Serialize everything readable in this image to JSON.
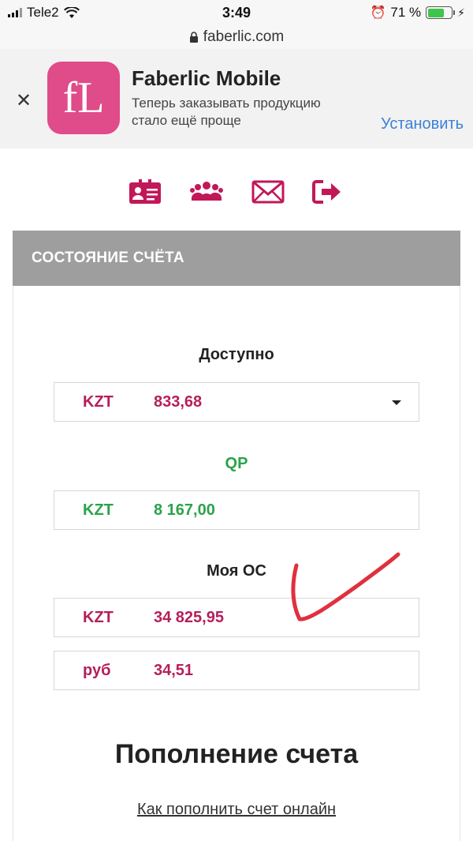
{
  "status_bar": {
    "carrier": "Tele2",
    "time": "3:49",
    "battery_percent": "71 %",
    "battery_level": 0.71
  },
  "url_bar": {
    "url": "faberlic.com"
  },
  "app_banner": {
    "icon_text": "fL",
    "app_name": "Faberlic Mobile",
    "description_line1": "Теперь заказывать продукцию",
    "description_line2": "стало ещё проще",
    "install_label": "Установить",
    "icon_color": "#e04b8a"
  },
  "nav_icons": [
    "id-card-icon",
    "users-group-icon",
    "mail-icon",
    "logout-icon"
  ],
  "account": {
    "header": "СОСТОЯНИЕ СЧЁТА",
    "available": {
      "title": "Доступно",
      "currency": "KZT",
      "value": "833,68"
    },
    "qp": {
      "title": "QP",
      "currency": "KZT",
      "value": "8 167,00"
    },
    "my_os": {
      "title": "Моя ОС",
      "rows": [
        {
          "currency": "KZT",
          "value": "34 825,95"
        },
        {
          "currency": "руб",
          "value": "34,51"
        }
      ]
    }
  },
  "refill": {
    "title": "Пополнение счета",
    "link": "Как пополнить счет онлайн"
  },
  "colors": {
    "accent": "#c1185a",
    "value_magenta": "#b51f5a",
    "value_green": "#2aa34a",
    "header_gray": "#9e9e9e",
    "link_blue": "#3b82d8",
    "annotation_red": "#e0303f"
  }
}
